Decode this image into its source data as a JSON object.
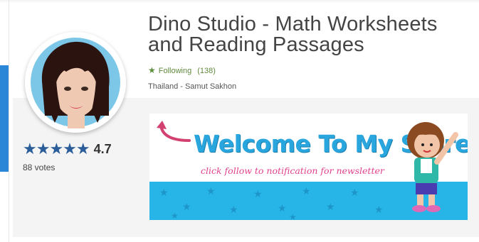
{
  "store": {
    "title": "Dino Studio - Math Worksheets and Reading Passages",
    "follow_label": "Following",
    "follow_count": "(138)",
    "location": "Thailand - Samut Sakhon"
  },
  "rating": {
    "value": "4.7",
    "votes": "88 votes",
    "stars_glyph": "★★★★★"
  },
  "banner": {
    "headline": "Welcome To My Store",
    "subline": "click follow to notification for newsletter"
  },
  "icons": {
    "follow": "star-icon",
    "rating": "star-icon",
    "arrow": "curved-arrow-icon"
  },
  "colors": {
    "accent_blue": "#2a86d6",
    "rating_star": "#2a5d9a",
    "follow_green": "#5f8a3f",
    "banner_blue": "#27b5e8",
    "banner_pink": "#e0408c"
  }
}
